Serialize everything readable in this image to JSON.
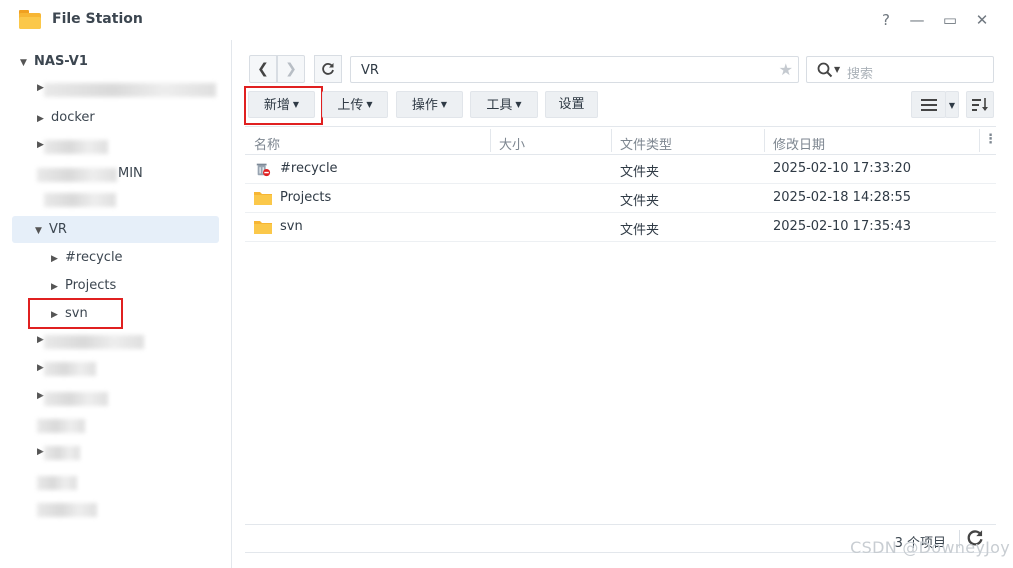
{
  "window": {
    "title": "File Station",
    "help": "?",
    "minimize": "—",
    "maximize": "▭",
    "close": "✕"
  },
  "sidebar": {
    "root": "NAS-V1",
    "items": [
      {
        "label": "docker"
      },
      {
        "label": "MIN"
      },
      {
        "label": "VR"
      },
      {
        "label": "#recycle"
      },
      {
        "label": "Projects"
      },
      {
        "label": "svn"
      }
    ]
  },
  "toolbar": {
    "path": "VR",
    "search_placeholder": "搜索",
    "new_label": "新增",
    "upload_label": "上传",
    "action_label": "操作",
    "tools_label": "工具",
    "settings_label": "设置"
  },
  "table": {
    "columns": [
      "名称",
      "大小",
      "文件类型",
      "修改日期"
    ],
    "rows": [
      {
        "name": "#recycle",
        "size": "",
        "type": "文件夹",
        "modified": "2025-02-10 17:33:20",
        "icon": "recycle-bin-icon"
      },
      {
        "name": "Projects",
        "size": "",
        "type": "文件夹",
        "modified": "2025-02-18 14:28:55",
        "icon": "folder-icon"
      },
      {
        "name": "svn",
        "size": "",
        "type": "文件夹",
        "modified": "2025-02-10 17:35:43",
        "icon": "folder-icon"
      }
    ]
  },
  "status": {
    "count": "3 个项目"
  },
  "watermark": "CSDN @DowneyJoy",
  "colors": {
    "highlight_box": "#e02020",
    "selected_row": "#e6eff9",
    "folder": "#f7b634"
  }
}
